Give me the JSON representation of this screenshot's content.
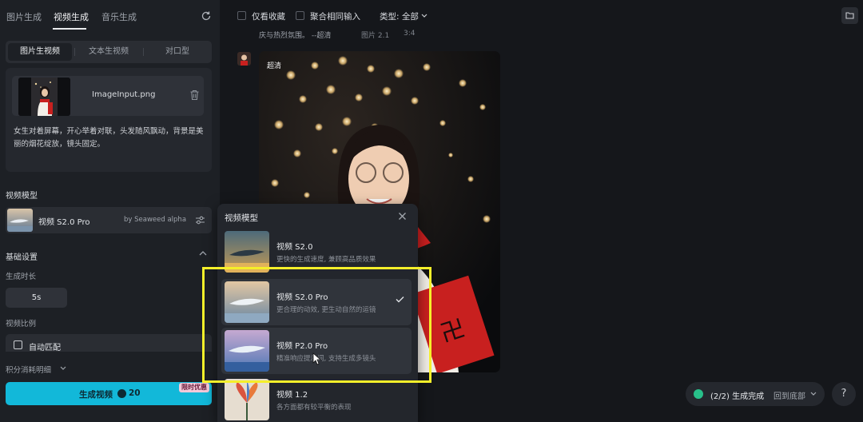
{
  "top_tabs": [
    "图片生成",
    "视频生成",
    "音乐生成"
  ],
  "sub_tabs": [
    "图片生视频",
    "文本生视频",
    "对口型"
  ],
  "upload": {
    "file_name": "ImageInput.png"
  },
  "prompt": "女生对着屏幕，开心举着对联，头发随风飘动，背景是美丽的烟花绽放，镜头固定。",
  "model_section": {
    "label": "视频模型",
    "name": "视频 S2.0 Pro",
    "by": "by Seaweed alpha"
  },
  "basic": {
    "label": "基础设置",
    "duration_label": "生成时长",
    "duration_value": "5s",
    "ratio_label": "视频比例",
    "ratio_value": "自动匹配"
  },
  "cost_label": "积分消耗明细",
  "generate": {
    "label": "生成视频",
    "count": "20",
    "promo": "限时优惠"
  },
  "toolbar": {
    "fav_only": "仅看收藏",
    "merge": "聚合相同输入",
    "type": "类型: 全部"
  },
  "caption": {
    "text": "庆与热烈氛围。 --超清",
    "ratio": "图片 2.1",
    "aspect": "3:4"
  },
  "result": {
    "hq_tag": "超清"
  },
  "status": {
    "text": "(2/2) 生成完成",
    "back": "回到底部"
  },
  "help": "?",
  "popup": {
    "title": "视频模型",
    "options": [
      {
        "name": "视频 S2.0",
        "desc": "更快的生成速度, 兼顾高品质效果"
      },
      {
        "name": "视频 S2.0 Pro",
        "desc": "更合理的动效, 更生动自然的运镜"
      },
      {
        "name": "视频 P2.0 Pro",
        "desc": "精准响应提示词, 支持生成多镜头"
      },
      {
        "name": "视频 1.2",
        "desc": "各方面都有较平衡的表现"
      }
    ]
  },
  "colors": {
    "accent": "#12b8d9",
    "highlight": "#f5ef2a",
    "success": "#28c08a"
  }
}
